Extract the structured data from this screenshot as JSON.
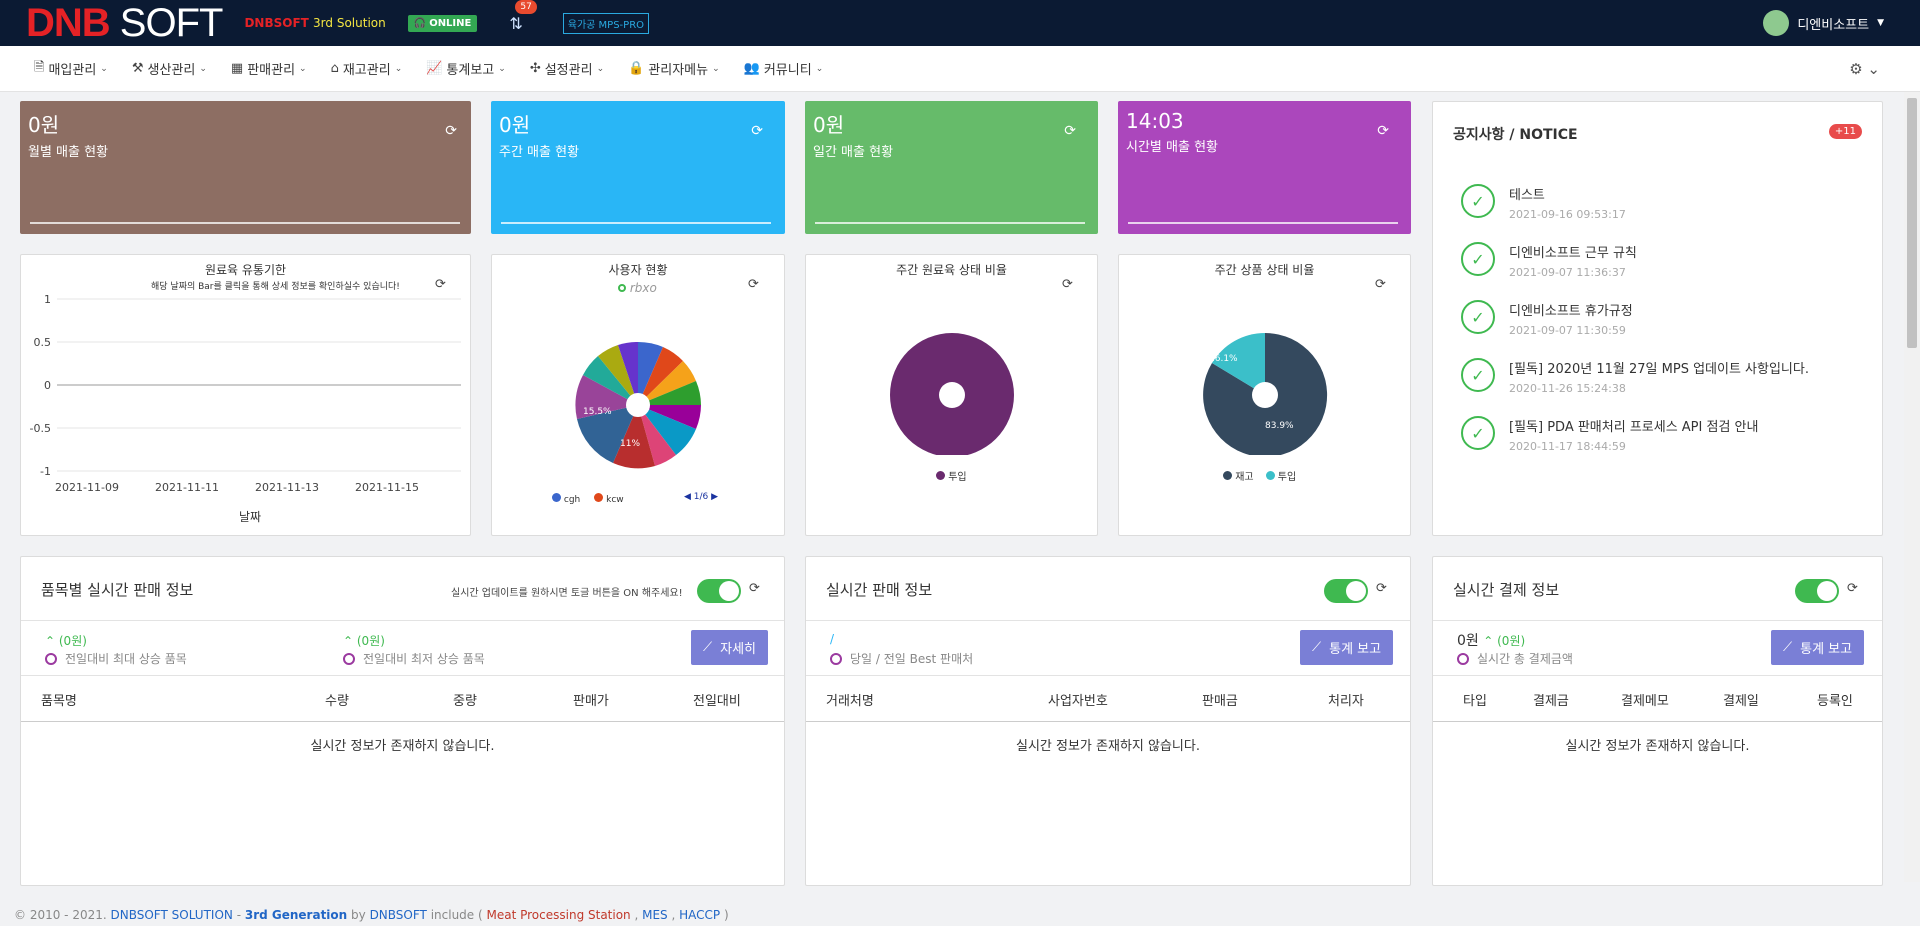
{
  "header": {
    "logo_dnb": "DNB",
    "logo_soft": "SOFT",
    "sub_brand": "DNBSOFT",
    "sub_suffix": "3rd Solution",
    "online_label": "ONLINE",
    "notif_count": "57",
    "mode_label": "육가공 MPS-PRO",
    "user_name": "디엔비소프트"
  },
  "nav": {
    "items": [
      {
        "label": "매입관리",
        "icon": "purchase-icon"
      },
      {
        "label": "생산관리",
        "icon": "tools-icon"
      },
      {
        "label": "판매관리",
        "icon": "qr-icon"
      },
      {
        "label": "재고관리",
        "icon": "warehouse-icon"
      },
      {
        "label": "통계보고",
        "icon": "chart-icon"
      },
      {
        "label": "설정관리",
        "icon": "puzzle-icon"
      },
      {
        "label": "관리자메뉴",
        "icon": "lock-icon"
      },
      {
        "label": "커뮤니티",
        "icon": "people-icon"
      }
    ]
  },
  "stats": [
    {
      "value": "0원",
      "label": "월별 매출 현황",
      "color": "#8d6e63"
    },
    {
      "value": "0원",
      "label": "주간 매출 현황",
      "color": "#29b6f6"
    },
    {
      "value": "0원",
      "label": "일간 매출 현황",
      "color": "#66bb6a"
    },
    {
      "value": "14:03",
      "label": "시간별 매출 현황",
      "color": "#ab47bc"
    }
  ],
  "charts": {
    "expiry": {
      "title": "원료육 유통기한",
      "hint": "해당 날짜의 Bar를 클릭을 통해 상세 정보를 확인하실수 있습니다!",
      "xlabel": "날짜",
      "yticks": [
        "1",
        "0.5",
        "0",
        "-0.5",
        "-1"
      ],
      "xticks": [
        "2021-11-09",
        "2021-11-11",
        "2021-11-13",
        "2021-11-15"
      ]
    },
    "users": {
      "title": "사용자 현황",
      "legend_top": "rbxo",
      "label1": "15.5%",
      "label2": "11%",
      "legend": [
        "cgh",
        "kcw"
      ],
      "pager": "1/6"
    },
    "raw": {
      "title": "주간 원료육 상태 비율",
      "legend": "투입"
    },
    "product": {
      "title": "주간 상품 상태 비율",
      "label_a": "83.9%",
      "label_b": "16.1%",
      "legend_a": "재고",
      "legend_b": "투입"
    }
  },
  "chart_data": [
    {
      "type": "line",
      "title": "원료육 유통기한",
      "xlabel": "날짜",
      "ylabel": "",
      "x": [
        "2021-11-09",
        "2021-11-11",
        "2021-11-13",
        "2021-11-15"
      ],
      "ylim": [
        -1,
        1
      ],
      "series": []
    },
    {
      "type": "pie",
      "title": "주간 원료육 상태 비율",
      "categories": [
        "투입"
      ],
      "values": [
        100
      ]
    },
    {
      "type": "pie",
      "title": "주간 상품 상태 비율",
      "categories": [
        "재고",
        "투입"
      ],
      "values": [
        83.9,
        16.1
      ]
    }
  ],
  "notice": {
    "title": "공지사항 / NOTICE",
    "badge": "+11",
    "items": [
      {
        "title": "테스트",
        "date": "2021-09-16 09:53:17"
      },
      {
        "title": "디엔비소프트 근무 규칙",
        "date": "2021-09-07 11:36:37"
      },
      {
        "title": "디엔비소프트 휴가규정",
        "date": "2021-09-07 11:30:59"
      },
      {
        "title": "[필독] 2020년 11월 27일 MPS 업데이트 사항입니다.",
        "date": "2020-11-26 15:24:38"
      },
      {
        "title": "[필독] PDA 판매처리 프로세스 API 점검 안내",
        "date": "2020-11-17 18:44:59"
      }
    ]
  },
  "item_sales": {
    "title": "품목별 실시간 판매 정보",
    "hint": "실시간 업데이트를 원하시면 토글 버튼을 ON 해주세요!",
    "max_up": "(0원)",
    "max_label": "전일대비 최대 상승 품목",
    "min_up": "(0원)",
    "min_label": "전일대비 최저 상승 품목",
    "detail_btn": "자세히",
    "columns": [
      "품목명",
      "수량",
      "중량",
      "판매가",
      "전일대비"
    ],
    "empty": "실시간 정보가 존재하지 않습니다."
  },
  "sales": {
    "title": "실시간 판매 정보",
    "slash": "/",
    "best_label": "당일 / 전일 Best 판매처",
    "report_btn": "통계 보고",
    "columns": [
      "거래처명",
      "사업자번호",
      "판매금",
      "처리자"
    ],
    "empty": "실시간 정보가 존재하지 않습니다."
  },
  "payment": {
    "title": "실시간 결제 정보",
    "amount": "0원",
    "up": "(0원)",
    "total_label": "실시간 총 결제금액",
    "report_btn": "통계 보고",
    "columns": [
      "타입",
      "결제금",
      "결제메모",
      "결제일",
      "등록인"
    ],
    "empty": "실시간 정보가 존재하지 않습니다."
  },
  "footer": {
    "copy": "© 2010 - 2021.",
    "brand": "DNBSOFT SOLUTION",
    "sep": " - ",
    "gen": "3rd Generation",
    "by": " by ",
    "company": "DNBSOFT",
    "include": " include ( ",
    "mps": "Meat Processing Station",
    "comma1": " , ",
    "mes": "MES",
    "comma2": " , ",
    "haccp": "HACCP",
    "close": " )"
  }
}
